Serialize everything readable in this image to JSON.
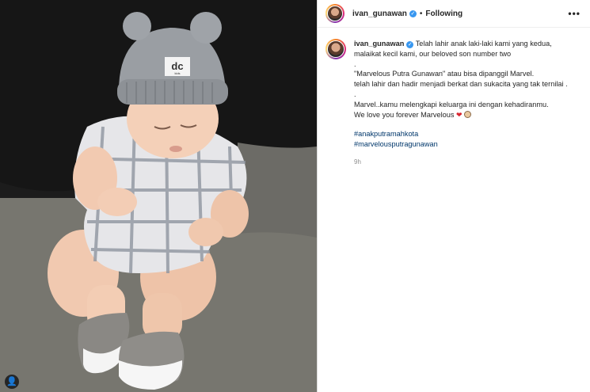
{
  "post": {
    "username": "ivan_gunawan",
    "follow_status": "Following",
    "separator": "•",
    "more_label": "•••",
    "verified_symbol": "✓",
    "tag_symbol": "👤"
  },
  "caption": {
    "username": "ivan_gunawan",
    "line1": " Telah lahir anak laki-laki kami yang kedua,",
    "line2": "malaikat kecil kami, our beloved son number two",
    "line3": ".",
    "line4": "\"Marvelous Putra Gunawan\" atau bisa dipanggil Marvel.",
    "line5": "telah lahir dan hadir menjadi berkat dan sukacita yang tak ternilai .",
    "line6": ".",
    "line7": "Marvel..kamu melengkapi keluarga ini dengan kehadiranmu.",
    "line8": "We love you forever Marvelous ",
    "heart_emoji": "❤",
    "hashtag1": "#anakputramahkota",
    "hashtag2": "#marvelousputragunawan",
    "time_ago": "9h"
  },
  "hat_logo": "dc",
  "hat_logo_sub": "kids",
  "colors": {
    "verified": "#3897f0",
    "hashtag": "#00376b",
    "text": "#262626",
    "muted": "#8e8e8e",
    "heart": "#d9232e"
  }
}
